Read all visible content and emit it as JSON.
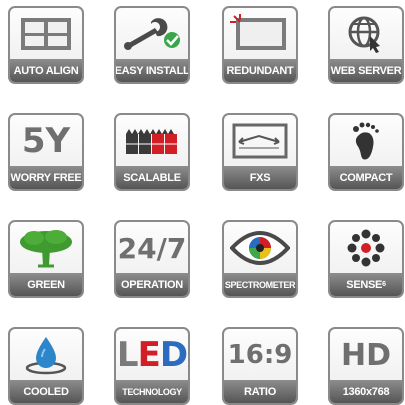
{
  "tiles": [
    {
      "label": "AUTO ALIGN",
      "icon": "monitor-grid-icon"
    },
    {
      "label": "EASY INSTALL",
      "icon": "wrench-check-icon"
    },
    {
      "label": "REDUNDANT",
      "icon": "monitor-alert-icon"
    },
    {
      "label": "WEB SERVER",
      "icon": "globe-cursor-icon"
    },
    {
      "label": "WORRY FREE",
      "icon": "warranty-5y-icon",
      "text": "5Y"
    },
    {
      "label": "SCALABLE",
      "icon": "led-blocks-icon"
    },
    {
      "label": "FXS",
      "icon": "monitor-arrows-icon"
    },
    {
      "label": "COMPACT",
      "icon": "footprint-icon"
    },
    {
      "label": "GREEN",
      "icon": "tree-icon"
    },
    {
      "label": "OPERATION",
      "icon": "hours-24-7-icon",
      "text": "24/7"
    },
    {
      "label": "SPECTROMETER",
      "icon": "eye-spectrum-icon"
    },
    {
      "label": "SENSE",
      "label_sup": "6",
      "icon": "sensor-dots-icon"
    },
    {
      "label": "COOLED",
      "icon": "water-drop-icon"
    },
    {
      "label": "TECHNOLOGY",
      "icon": "led-letters-icon",
      "text_l": "L",
      "text_e": "E",
      "text_d": "D"
    },
    {
      "label": "RATIO",
      "icon": "aspect-ratio-icon",
      "text": "16:9"
    },
    {
      "label": "1360x768",
      "icon": "hd-icon",
      "text": "HD"
    }
  ],
  "colors": {
    "tile_border": "#8a8a8a",
    "label_bg": "#6a6a6a",
    "green_check": "#3aa64a",
    "tree_green": "#3f9b2f",
    "drop_blue": "#2c86c9",
    "led_red": "#d21f26",
    "led_green": "#3ea84a",
    "led_blue": "#2b6cc0"
  }
}
